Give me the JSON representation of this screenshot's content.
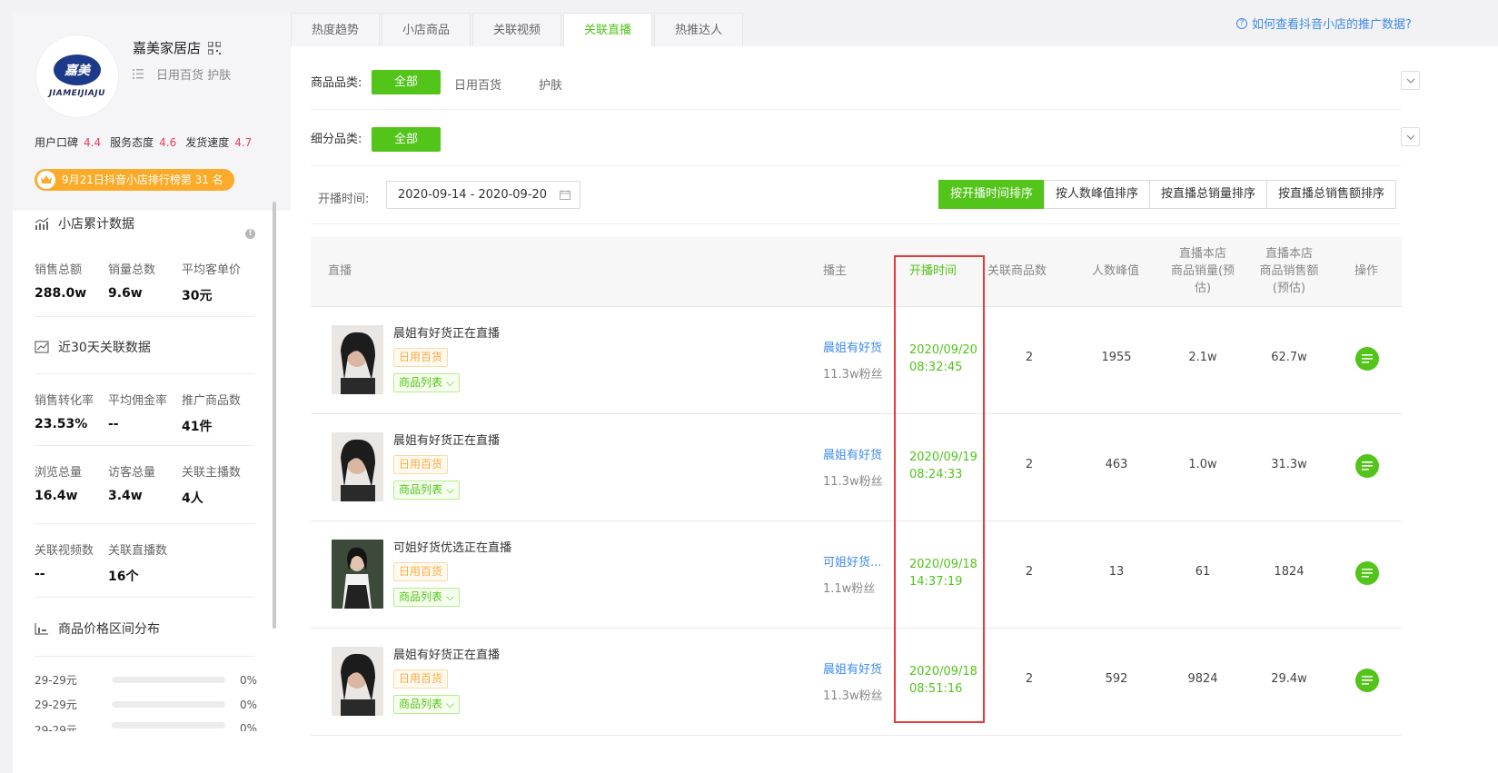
{
  "shop": {
    "logo_text": "JIAMEIJIAJU",
    "logo_mark": "嘉美",
    "name": "嘉美家居店",
    "categories": "日用百货 护肤",
    "scores": [
      {
        "label": "用户口碑",
        "value": "4.4"
      },
      {
        "label": "服务态度",
        "value": "4.6"
      },
      {
        "label": "发货速度",
        "value": "4.7"
      }
    ],
    "rank_text": "9月21日抖音小店排行榜第 31 名"
  },
  "cumulative": {
    "title": "小店累计数据",
    "stats": [
      {
        "label": "销售总额",
        "value": "288.0w"
      },
      {
        "label": "销量总数",
        "value": "9.6w"
      },
      {
        "label": "平均客单价",
        "value": "30元"
      }
    ]
  },
  "recent30": {
    "title": "近30天关联数据",
    "stats": [
      {
        "label": "销售转化率",
        "value": "23.53%"
      },
      {
        "label": "平均佣金率",
        "value": "--"
      },
      {
        "label": "推广商品数",
        "value": "41件"
      },
      {
        "label": "浏览总量",
        "value": "16.4w"
      },
      {
        "label": "访客总量",
        "value": "3.4w"
      },
      {
        "label": "关联主播数",
        "value": "4人"
      },
      {
        "label": "关联视频数",
        "value": "--"
      },
      {
        "label": "关联直播数",
        "value": "16个"
      }
    ]
  },
  "price_dist": {
    "title": "商品价格区间分布",
    "rows": [
      {
        "label": "29-29元",
        "pct": "0%"
      },
      {
        "label": "29-29元",
        "pct": "0%"
      },
      {
        "label": "29-29元",
        "pct": "0%"
      }
    ]
  },
  "tabs": [
    "热度趋势",
    "小店商品",
    "关联视频",
    "关联直播",
    "热推达人"
  ],
  "active_tab_index": 3,
  "help_link": "如何查看抖音小店的推广数据?",
  "filters": {
    "category_label": "商品品类:",
    "category_all": "全部",
    "category_options": [
      "日用百货",
      "护肤"
    ],
    "subcategory_label": "细分品类:",
    "subcategory_all": "全部"
  },
  "date": {
    "label": "开播时间:",
    "range": "2020-09-14 - 2020-09-20"
  },
  "sort_buttons": [
    "按开播时间排序",
    "按人数峰值排序",
    "按直播总销量排序",
    "按直播总销售额排序"
  ],
  "table": {
    "headers": {
      "live": "直播",
      "anchor": "播主",
      "start_time": "开播时间",
      "product_count": "关联商品数",
      "peak": "人数峰值",
      "sales_l1": "直播本店",
      "sales_l2": "商品销量(预",
      "sales_l3": "估)",
      "revenue_l1": "直播本店",
      "revenue_l2": "商品销售额",
      "revenue_l3": "(预估)",
      "op": "操作"
    },
    "rows": [
      {
        "title": "晨姐有好货正在直播",
        "category": "日用百货",
        "list_tag": "商品列表",
        "anchor": "晨姐有好货",
        "fans": "11.3w粉丝",
        "date": "2020/09/20",
        "time": "08:32:45",
        "products": "2",
        "peak": "1955",
        "sales": "2.1w",
        "revenue": "62.7w"
      },
      {
        "title": "晨姐有好货正在直播",
        "category": "日用百货",
        "list_tag": "商品列表",
        "anchor": "晨姐有好货",
        "fans": "11.3w粉丝",
        "date": "2020/09/19",
        "time": "08:24:33",
        "products": "2",
        "peak": "463",
        "sales": "1.0w",
        "revenue": "31.3w"
      },
      {
        "title": "可姐好货优选正在直播",
        "category": "日用百货",
        "list_tag": "商品列表",
        "anchor": "可姐好货...",
        "fans": "1.1w粉丝",
        "date": "2020/09/18",
        "time": "14:37:19",
        "products": "2",
        "peak": "13",
        "sales": "61",
        "revenue": "1824"
      },
      {
        "title": "晨姐有好货正在直播",
        "category": "日用百货",
        "list_tag": "商品列表",
        "anchor": "晨姐有好货",
        "fans": "11.3w粉丝",
        "date": "2020/09/18",
        "time": "08:51:16",
        "products": "2",
        "peak": "592",
        "sales": "9824",
        "revenue": "29.4w"
      }
    ]
  },
  "colors": {
    "accent": "#52c41a",
    "link": "#3d8be8",
    "score": "#f03c5a",
    "badge": "#fbab2a",
    "highlight_box": "#e8393b"
  }
}
